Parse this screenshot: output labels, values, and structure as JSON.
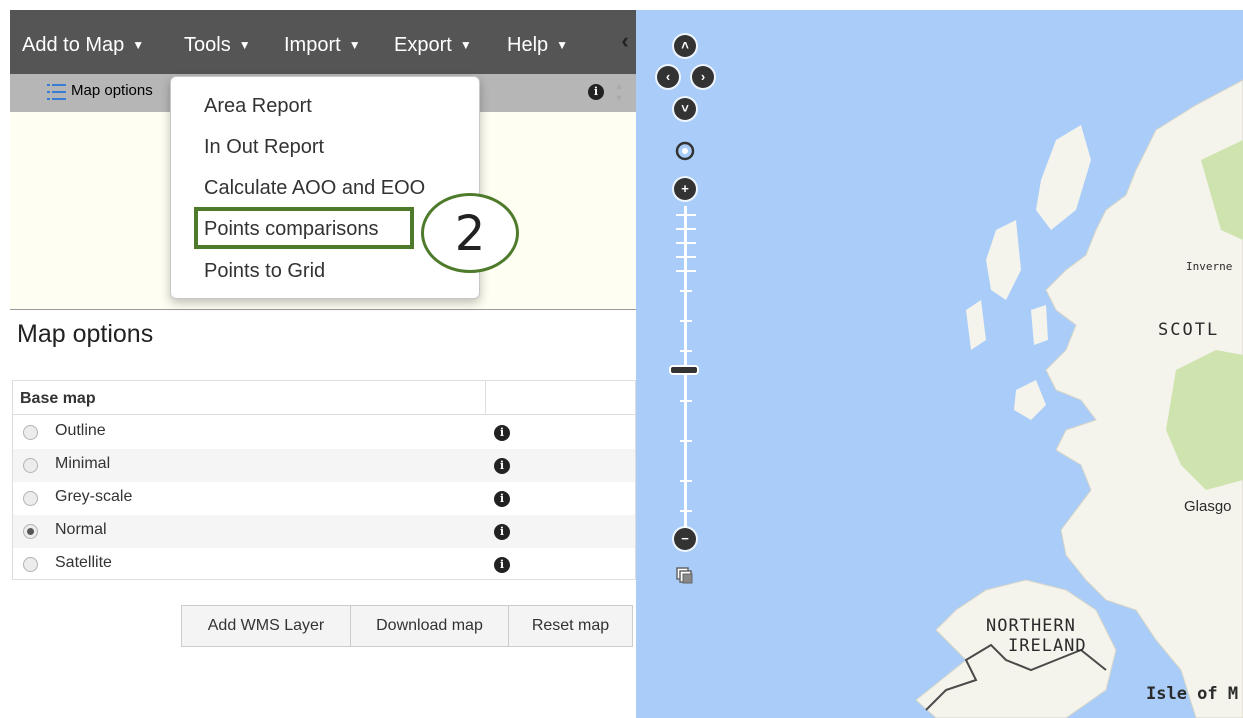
{
  "menubar": {
    "items": [
      {
        "label": "Add to Map"
      },
      {
        "label": "Tools"
      },
      {
        "label": "Import"
      },
      {
        "label": "Export"
      },
      {
        "label": "Help"
      }
    ],
    "collapse_glyph": "‹"
  },
  "subbar": {
    "label": "Map options",
    "icon": "list-icon"
  },
  "tools_dropdown": {
    "items": [
      {
        "label": "Area Report"
      },
      {
        "label": "In Out Report"
      },
      {
        "label": "Calculate AOO and EOO"
      },
      {
        "label": "Points comparisons"
      },
      {
        "label": "Points to Grid"
      }
    ],
    "highlighted_index": 3,
    "step_marker": "2",
    "highlight_color": "#4e7b2b"
  },
  "map_options": {
    "title": "Map options",
    "table_header": "Base map",
    "options": [
      {
        "label": "Outline",
        "checked": false
      },
      {
        "label": "Minimal",
        "checked": false
      },
      {
        "label": "Grey-scale",
        "checked": false
      },
      {
        "label": "Normal",
        "checked": true
      },
      {
        "label": "Satellite",
        "checked": false
      }
    ],
    "info_glyph": "i"
  },
  "buttons": {
    "add_wms": "Add WMS Layer",
    "download_map": "Download map",
    "reset_map": "Reset map"
  },
  "map": {
    "labels": {
      "inverness": "Inverne",
      "scotland": "SCOTL",
      "glasgow": "Glasgo",
      "northern": "NORTHERN",
      "ireland": "IRELAND",
      "isle_of_man": "Isle of M"
    },
    "colors": {
      "sea": "#a9cdf8",
      "land": "#f4f3ec",
      "green": "#cfe3ae",
      "border": "#4a4a4a"
    },
    "nav_glyphs": {
      "up": "˄",
      "left": "‹",
      "right": "›",
      "down": "˅",
      "zoom_in": "+",
      "zoom_out": "−"
    }
  }
}
